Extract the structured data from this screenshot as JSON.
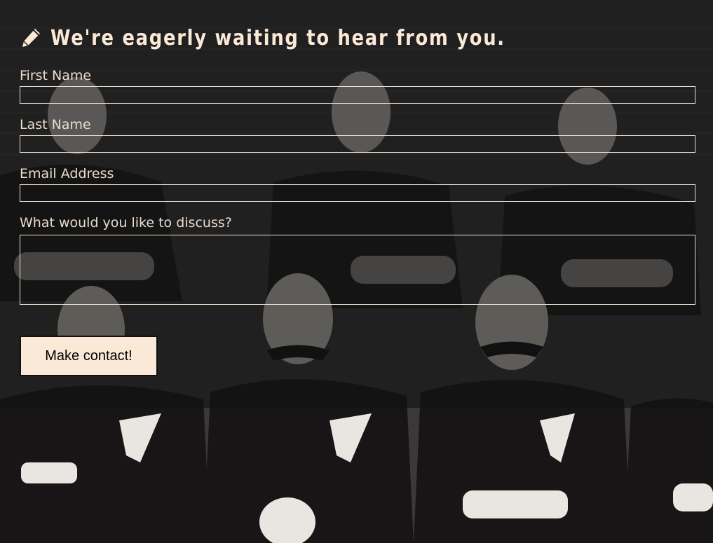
{
  "form": {
    "heading": "We're eagerly waiting to hear from you.",
    "heading_icon": "pencil-icon",
    "fields": {
      "first_name": {
        "label": "First Name",
        "value": ""
      },
      "last_name": {
        "label": "Last Name",
        "value": ""
      },
      "email": {
        "label": "Email Address",
        "value": ""
      },
      "message": {
        "label": "What would you like to discuss?",
        "value": ""
      }
    },
    "submit_label": "Make contact!"
  },
  "colors": {
    "text_cream": "#fbe9d7",
    "label": "#e8dccf",
    "button_bg": "#fbe9d7",
    "overlay": "#121112"
  },
  "background": {
    "image": "sepia-team-photograph"
  }
}
